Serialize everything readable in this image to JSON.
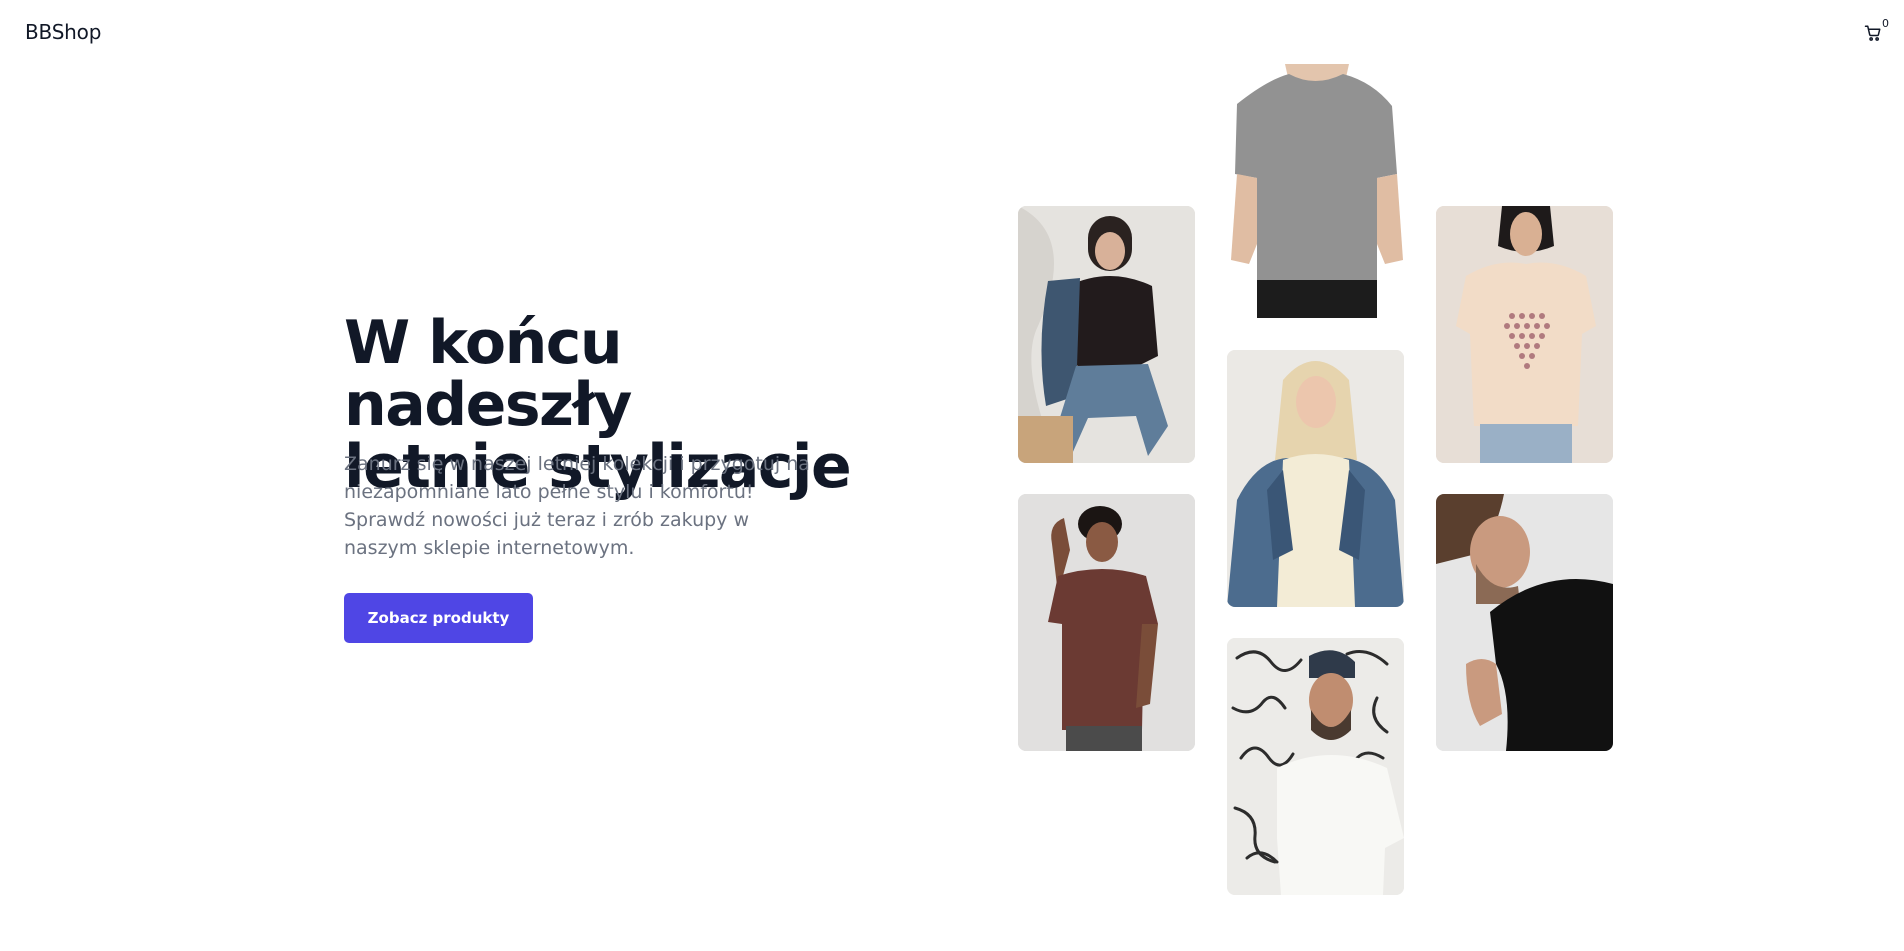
{
  "header": {
    "brand": "BBShop",
    "cart_icon": "cart-icon",
    "cart_count": "0"
  },
  "hero": {
    "title_line1": "W końcu nadeszły",
    "title_line2": "letnie stylizacje",
    "description": "Zanurz się w naszej letniej kolekcji i przygotuj na niezapomniane lato pełne stylu i komfortu! Sprawdź nowości już teraz i zrób zakupy w naszym sklepie internetowym.",
    "cta_label": "Zobacz produkty"
  },
  "colors": {
    "accent": "#4f46e5",
    "heading": "#111827",
    "body_text": "#6b7280",
    "background": "#ffffff"
  }
}
